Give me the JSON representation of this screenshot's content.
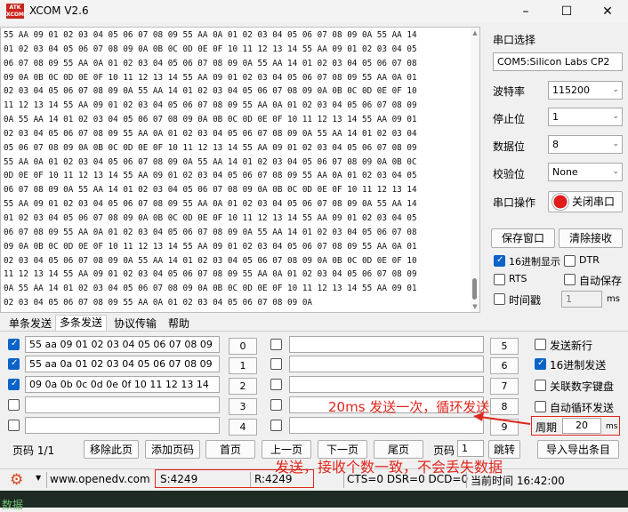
{
  "window": {
    "title": "XCOM V2.6",
    "logo": "ATK XCOM"
  },
  "receive_lines": [
    "55 AA 09 01 02 03 04 05 06 07 08 09 55 AA 0A 01 02 03 04 05 06 07 08 09 0A 55 AA 14",
    "01 02 03 04 05 06 07 08 09 0A 0B 0C 0D 0E 0F 10 11 12 13 14 55 AA 09 01 02 03 04 05",
    "06 07 08 09 55 AA 0A 01 02 03 04 05 06 07 08 09 0A 55 AA 14 01 02 03 04 05 06 07 08",
    "09 0A 0B 0C 0D 0E 0F 10 11 12 13 14 55 AA 09 01 02 03 04 05 06 07 08 09 55 AA 0A 01",
    "02 03 04 05 06 07 08 09 0A 55 AA 14 01 02 03 04 05 06 07 08 09 0A 0B 0C 0D 0E 0F 10",
    "11 12 13 14 55 AA 09 01 02 03 04 05 06 07 08 09 55 AA 0A 01 02 03 04 05 06 07 08 09",
    "0A 55 AA 14 01 02 03 04 05 06 07 08 09 0A 0B 0C 0D 0E 0F 10 11 12 13 14 55 AA 09 01",
    "02 03 04 05 06 07 08 09 55 AA 0A 01 02 03 04 05 06 07 08 09 0A 55 AA 14 01 02 03 04",
    "05 06 07 08 09 0A 0B 0C 0D 0E 0F 10 11 12 13 14 55 AA 09 01 02 03 04 05 06 07 08 09",
    "55 AA 0A 01 02 03 04 05 06 07 08 09 0A 55 AA 14 01 02 03 04 05 06 07 08 09 0A 0B 0C",
    "0D 0E 0F 10 11 12 13 14 55 AA 09 01 02 03 04 05 06 07 08 09 55 AA 0A 01 02 03 04 05",
    "06 07 08 09 0A 55 AA 14 01 02 03 04 05 06 07 08 09 0A 0B 0C 0D 0E 0F 10 11 12 13 14",
    "55 AA 09 01 02 03 04 05 06 07 08 09 55 AA 0A 01 02 03 04 05 06 07 08 09 0A 55 AA 14",
    "01 02 03 04 05 06 07 08 09 0A 0B 0C 0D 0E 0F 10 11 12 13 14 55 AA 09 01 02 03 04 05",
    "06 07 08 09 55 AA 0A 01 02 03 04 05 06 07 08 09 0A 55 AA 14 01 02 03 04 05 06 07 08",
    "09 0A 0B 0C 0D 0E 0F 10 11 12 13 14 55 AA 09 01 02 03 04 05 06 07 08 09 55 AA 0A 01",
    "02 03 04 05 06 07 08 09 0A 55 AA 14 01 02 03 04 05 06 07 08 09 0A 0B 0C 0D 0E 0F 10",
    "11 12 13 14 55 AA 09 01 02 03 04 05 06 07 08 09 55 AA 0A 01 02 03 04 05 06 07 08 09",
    "0A 55 AA 14 01 02 03 04 05 06 07 08 09 0A 0B 0C 0D 0E 0F 10 11 12 13 14 55 AA 09 01",
    "02 03 04 05 06 07 08 09 55 AA 0A 01 02 03 04 05 06 07 08 09 0A"
  ],
  "port_panel": {
    "port_select_label": "串口选择",
    "port_value": "COM5:Silicon Labs CP2",
    "baud_label": "波特率",
    "baud_value": "115200",
    "stop_label": "停止位",
    "stop_value": "1",
    "data_label": "数据位",
    "data_value": "8",
    "parity_label": "校验位",
    "parity_value": "None",
    "op_label": "串口操作",
    "op_button": "关闭串口",
    "save_window": "保存窗口",
    "clear_recv": "清除接收",
    "hex_display": "16进制显示",
    "dtr": "DTR",
    "rts": "RTS",
    "auto_save": "自动保存",
    "timestamp": "时间戳",
    "ts_value": "1",
    "ts_unit": "ms"
  },
  "tabs": [
    "单条发送",
    "多条发送",
    "协议传输",
    "帮助"
  ],
  "multi_send": {
    "left": [
      {
        "text": "55 aa 09 01 02 03 04 05 06 07 08 09",
        "checked": true,
        "num": "0"
      },
      {
        "text": "55 aa 0a 01 02 03 04 05 06 07 08 09",
        "checked": true,
        "num": "1"
      },
      {
        "text": " 09 0a 0b 0c 0d 0e 0f 10 11 12 13 14",
        "checked": true,
        "num": "2"
      },
      {
        "text": "",
        "checked": false,
        "num": "3"
      },
      {
        "text": "",
        "checked": false,
        "num": "4"
      }
    ],
    "right": [
      {
        "text": "",
        "checked": false,
        "num": "5"
      },
      {
        "text": "",
        "checked": false,
        "num": "6"
      },
      {
        "text": "",
        "checked": false,
        "num": "7"
      },
      {
        "text": "",
        "checked": false,
        "num": "8"
      },
      {
        "text": "",
        "checked": false,
        "num": "9"
      }
    ]
  },
  "send_options": {
    "send_newline": "发送新行",
    "hex_send": "16进制发送",
    "keypad": "关联数字键盘",
    "auto_loop": "自动循环发送",
    "period_label": "周期",
    "period_value": "20",
    "period_unit": "ms"
  },
  "pager": {
    "page_label": "页码 1/1",
    "remove_page": "移除此页",
    "add_page": "添加页码",
    "first": "首页",
    "prev": "上一页",
    "next": "下一页",
    "last": "尾页",
    "page_label2": "页码",
    "page_value": "1",
    "jump": "跳转",
    "import_export": "导入导出条目"
  },
  "annotations": {
    "loop_note": "20ms 发送一次，循环发送",
    "count_note": "发送，接收个数一致，不会丢失数据"
  },
  "status": {
    "url": "www.openedv.com",
    "send_count": "S:4249",
    "recv_count": "R:4249",
    "signals": "CTS=0 DSR=0 DCD=0",
    "time": "当前时间 16:42:00"
  },
  "below_text": "数据"
}
